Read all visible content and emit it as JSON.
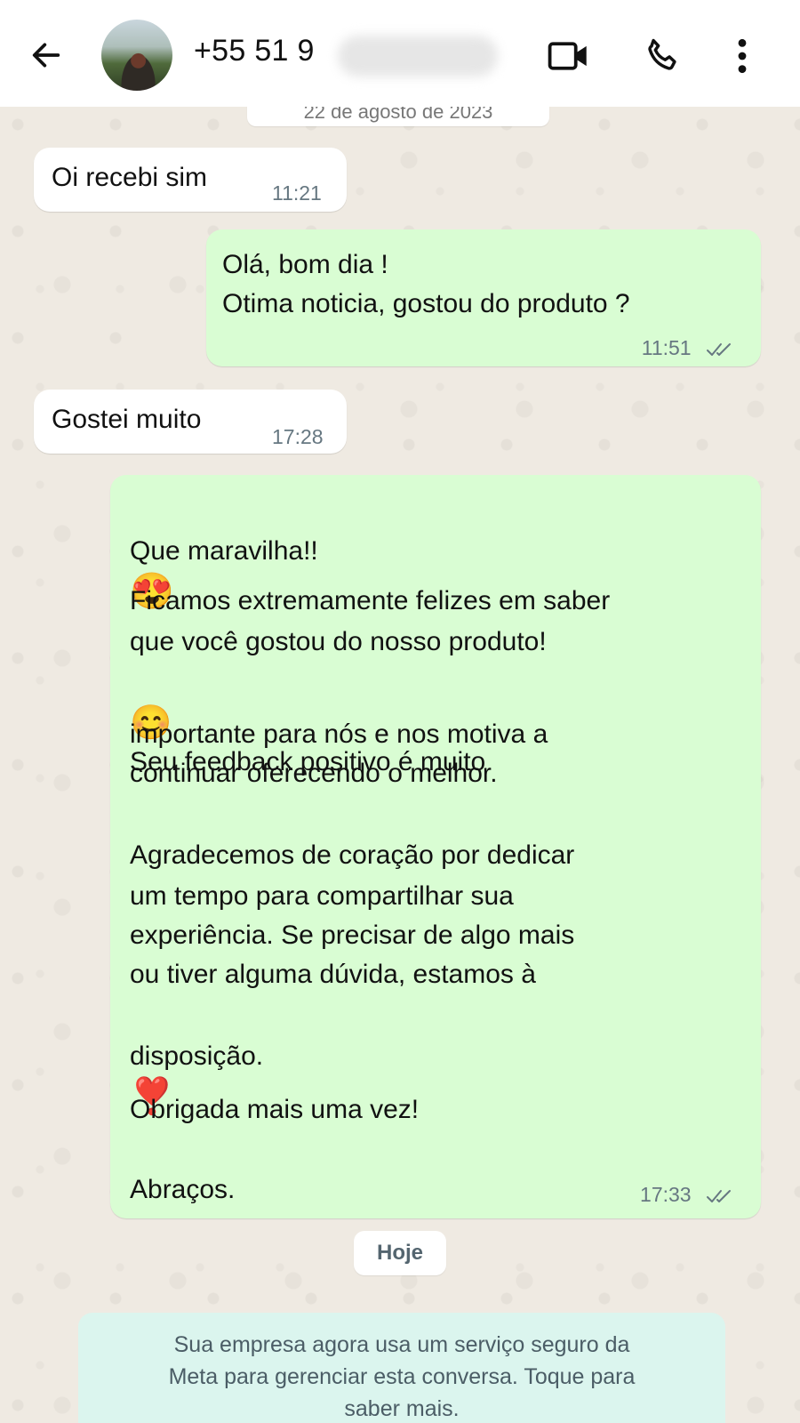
{
  "header": {
    "contact_name": "+55 51 9",
    "back_icon": "arrow-left-icon",
    "video_icon": "video-camera-icon",
    "call_icon": "phone-icon",
    "menu_icon": "more-vertical-icon"
  },
  "chat": {
    "top_date": "22 de agosto de 2023",
    "messages": [
      {
        "direction": "in",
        "text": "Oi recebi sim",
        "time": "11:21"
      },
      {
        "direction": "out",
        "line1": "Olá, bom dia !",
        "line2": "Otima noticia, gostou do produto ?",
        "time": "11:51",
        "status": "read"
      },
      {
        "direction": "in",
        "text": "Gostei muito",
        "time": "17:28"
      },
      {
        "direction": "out",
        "l1": "Que maravilha!!",
        "l1_emoji": "😍",
        "l2": "Ficamos extremamente felizes em saber",
        "l3": "que você gostou do nosso produto!",
        "l4_emoji": "😊",
        "l4": "Seu feedback positivo é muito",
        "l5": "importante para nós e nos motiva a",
        "l6": "continuar oferecendo o melhor.",
        "l7": "Agradecemos de coração por dedicar",
        "l8": "um tempo para compartilhar sua",
        "l9": "experiência. Se precisar de algo mais",
        "l10": "ou tiver alguma dúvida, estamos à",
        "l11": "disposição.",
        "l11_emoji": "❣️",
        "l12": "Obrigada mais uma vez!",
        "l13": "Abraços.",
        "time": "17:33",
        "status": "read"
      }
    ],
    "date_pill": "Hoje",
    "notice_line1": "Sua empresa agora usa um serviço seguro da",
    "notice_line2": "Meta para gerenciar esta conversa. Toque para",
    "notice_line3": "saber mais."
  },
  "colors": {
    "header_bg": "#ffffff",
    "chat_bg": "#efeae2",
    "outgoing_bubble": "#d9fdd3",
    "incoming_bubble": "#ffffff",
    "notice_bg": "#dbf5ee",
    "read_ticks": "#667781"
  }
}
